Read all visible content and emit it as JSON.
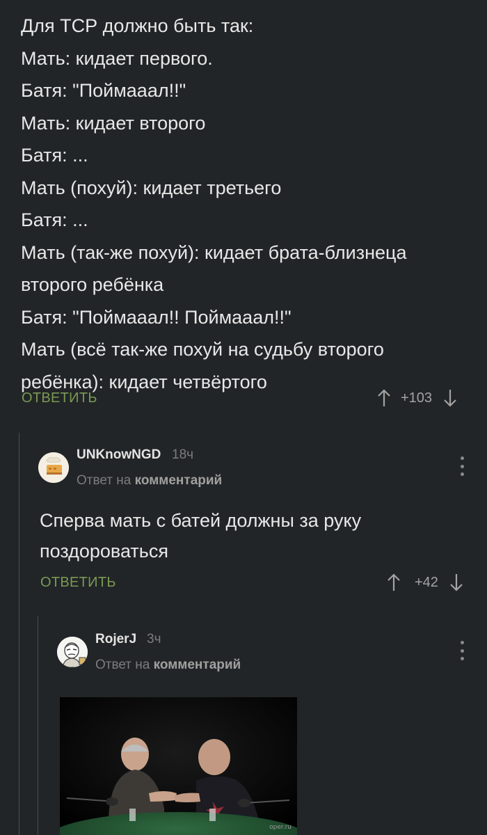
{
  "root_comment": {
    "lines": [
      "Для ТСР должно быть так:",
      "Мать: кидает первого.",
      "Батя: \"Поймааал!!\"",
      "Мать: кидает второго",
      "Батя: ...",
      "Мать (похуй): кидает третьего",
      "Батя: ...",
      "Мать (так-же похуй): кидает брата-близнеца",
      "второго ребёнка",
      "Батя: \"Поймааал!! Поймааал!!\"",
      "Мать (всё так-же похуй на судьбу второго",
      "ребёнка): кидает четвёртого"
    ],
    "reply_label": "ОТВЕТИТЬ",
    "rating": "+103"
  },
  "reply1": {
    "username": "UNKnowNGD",
    "time": "18ч",
    "reply_prefix": "Ответ на",
    "reply_target": "комментарий",
    "text_lines": [
      "Сперва мать с батей должны за руку",
      "поздороваться"
    ],
    "reply_label": "ОТВЕТИТЬ",
    "rating": "+42"
  },
  "reply2": {
    "username": "RojerJ",
    "time": "3ч",
    "reply_prefix": "Ответ на",
    "reply_target": "комментарий",
    "media_watermark": "oper.ru"
  },
  "colors": {
    "background": "#222527",
    "accent_reply": "#7a9a55",
    "text": "#e8e8e8",
    "muted": "#7c7c7c"
  },
  "icons": [
    "arrow-up-icon",
    "arrow-down-icon",
    "more-vertical-icon"
  ]
}
